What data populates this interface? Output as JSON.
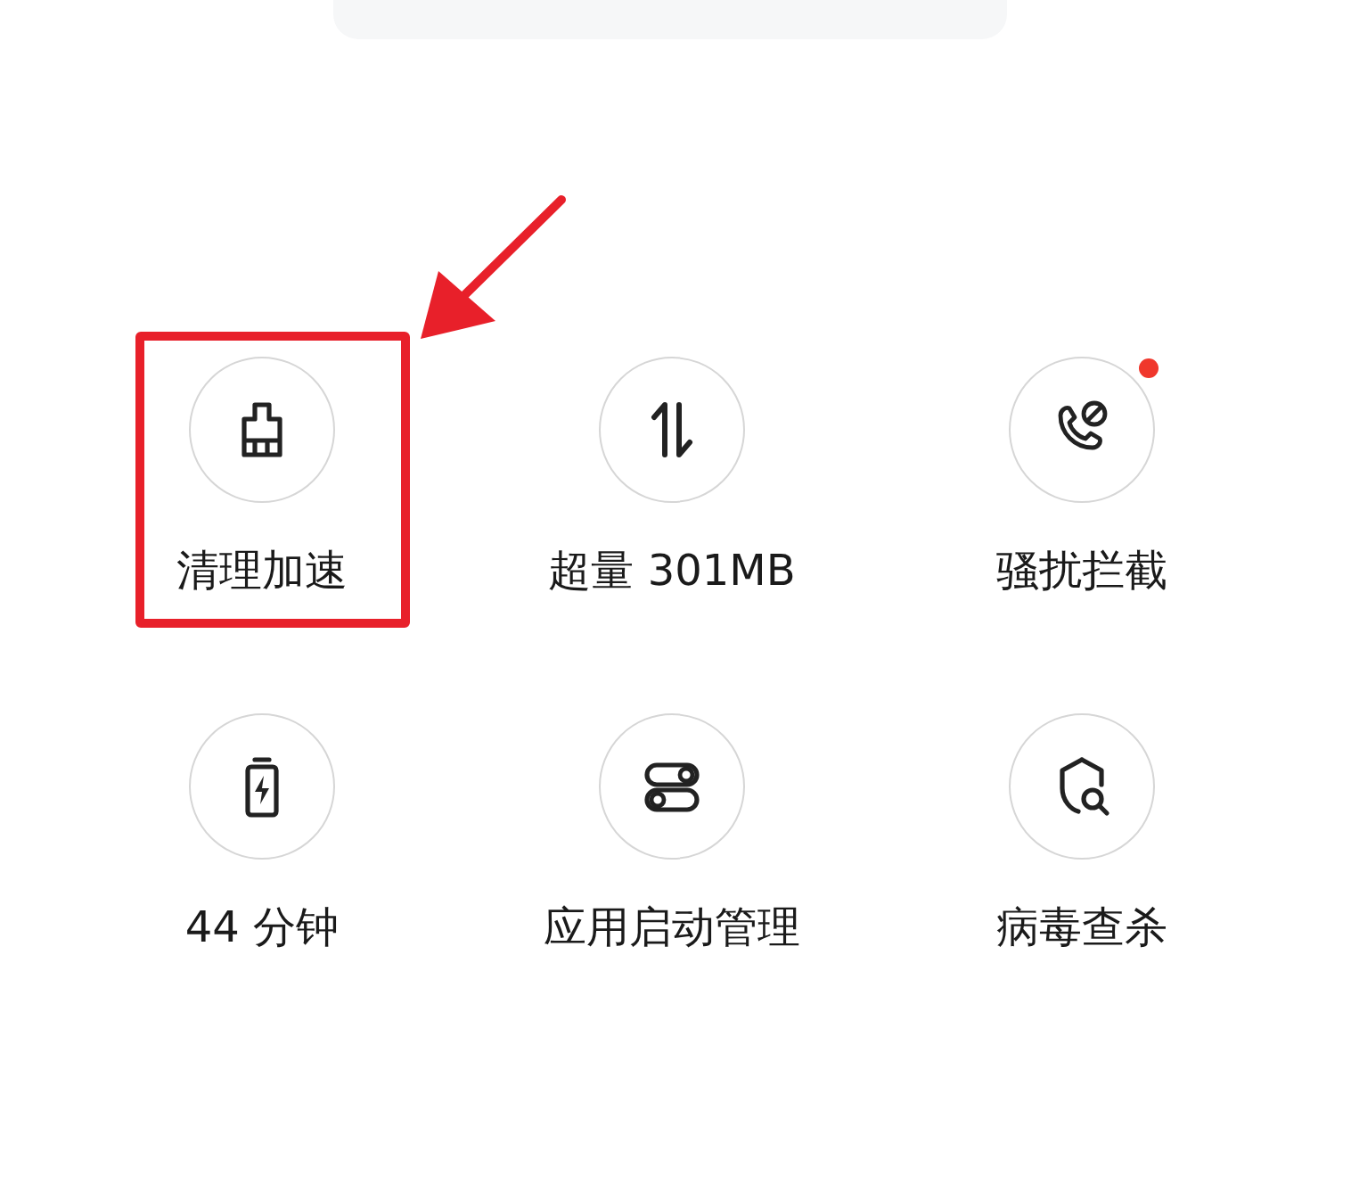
{
  "tools": [
    {
      "label": "清理加速",
      "highlighted": true,
      "badge": false
    },
    {
      "label": "超量 301MB",
      "highlighted": false,
      "badge": false
    },
    {
      "label": "骚扰拦截",
      "highlighted": false,
      "badge": true
    },
    {
      "label": "44 分钟",
      "highlighted": false,
      "badge": false
    },
    {
      "label": "应用启动管理",
      "highlighted": false,
      "badge": false
    },
    {
      "label": "病毒查杀",
      "highlighted": false,
      "badge": false
    }
  ]
}
